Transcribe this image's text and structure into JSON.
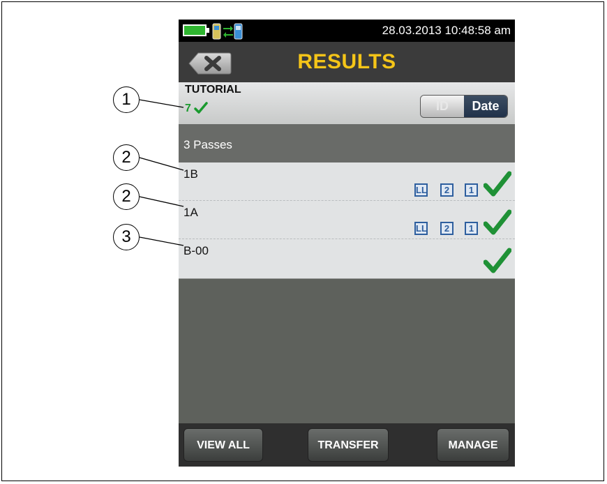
{
  "status_bar": {
    "datetime": "28.03.2013 10:48:58 am",
    "battery_icon": "battery-icon",
    "connection_icon": "connection-icon"
  },
  "header": {
    "title": "RESULTS",
    "back_icon": "close-icon"
  },
  "project": {
    "name": "TUTORIAL",
    "count": "7",
    "count_icon": "check-icon"
  },
  "sort": {
    "id_label": "ID",
    "date_label": "Date",
    "selected": "Date"
  },
  "section": {
    "label": "3 Passes"
  },
  "results": [
    {
      "id": "1B",
      "badges": [
        "LL",
        "2",
        "1"
      ],
      "status": "pass"
    },
    {
      "id": "1A",
      "badges": [
        "LL",
        "2",
        "1"
      ],
      "status": "pass"
    },
    {
      "id": "B-00",
      "badges": [],
      "status": "pass"
    }
  ],
  "footer": {
    "view_all": "VIEW ALL",
    "transfer": "TRANSFER",
    "manage": "MANAGE"
  },
  "callouts": [
    "1",
    "2",
    "2",
    "3"
  ],
  "colors": {
    "title": "#f5c518",
    "pass_green": "#1a9a2e",
    "badge_blue": "#2d5e9e",
    "status_bar": "#000000"
  }
}
